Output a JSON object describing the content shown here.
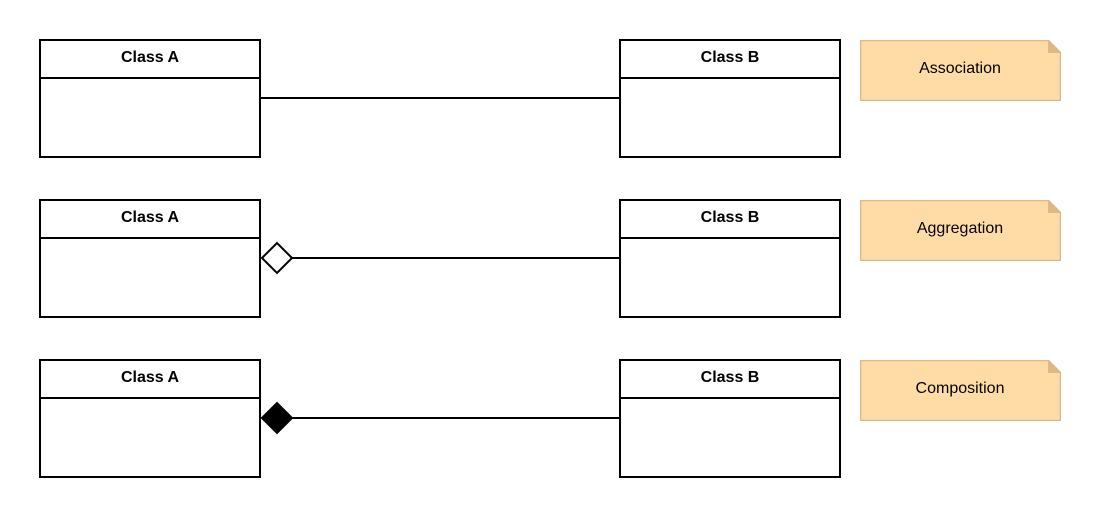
{
  "diagram": {
    "type": "uml-class-relationships",
    "colors": {
      "line": "#000000",
      "class_fill": "#FFFFFF",
      "note_fill": "#FFDBA5",
      "note_border": "#E0B985",
      "note_fold": "#D9B889"
    },
    "rows": [
      {
        "relationship": "association",
        "source": {
          "title": "Class A"
        },
        "target": {
          "title": "Class B"
        },
        "note": "Association",
        "end_marker": "none"
      },
      {
        "relationship": "aggregation",
        "source": {
          "title": "Class A"
        },
        "target": {
          "title": "Class B"
        },
        "note": "Aggregation",
        "end_marker": "hollow-diamond"
      },
      {
        "relationship": "composition",
        "source": {
          "title": "Class A"
        },
        "target": {
          "title": "Class B"
        },
        "note": "Composition",
        "end_marker": "filled-diamond"
      }
    ]
  }
}
